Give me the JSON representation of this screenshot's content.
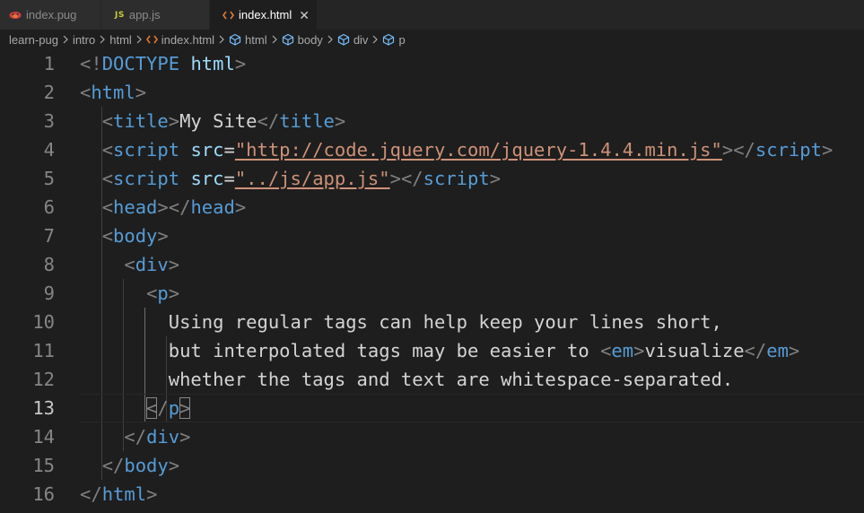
{
  "tabs": [
    {
      "label": "index.pug",
      "icon": "pug-icon"
    },
    {
      "label": "app.js",
      "icon": "js-icon",
      "icon_text": "JS"
    },
    {
      "label": "index.html",
      "icon": "html-icon",
      "icon_text": "<>",
      "close": "✕"
    }
  ],
  "breadcrumb": {
    "folders": [
      "learn-pug",
      "intro",
      "html"
    ],
    "file": "index.html",
    "symbols": [
      "html",
      "body",
      "div",
      "p"
    ]
  },
  "editor": {
    "current_line": 13,
    "lines": [
      {
        "n": "1",
        "tokens": [
          [
            "b",
            "<!"
          ],
          [
            "d",
            "DOCTYPE"
          ],
          [
            "t",
            " "
          ],
          [
            "a",
            "html"
          ],
          [
            "b",
            ">"
          ]
        ]
      },
      {
        "n": "2",
        "tokens": [
          [
            "b",
            "<"
          ],
          [
            "g",
            "html"
          ],
          [
            "b",
            ">"
          ]
        ]
      },
      {
        "n": "3",
        "tokens": [
          [
            "t",
            "  "
          ],
          [
            "b",
            "<"
          ],
          [
            "g",
            "title"
          ],
          [
            "b",
            ">"
          ],
          [
            "t",
            "My Site"
          ],
          [
            "b",
            "</"
          ],
          [
            "g",
            "title"
          ],
          [
            "b",
            ">"
          ]
        ]
      },
      {
        "n": "4",
        "tokens": [
          [
            "t",
            "  "
          ],
          [
            "b",
            "<"
          ],
          [
            "g",
            "script"
          ],
          [
            "t",
            " "
          ],
          [
            "a",
            "src"
          ],
          [
            "t",
            "="
          ],
          [
            "s",
            "\"http://code.jquery.com/jquery-1.4.4.min.js\""
          ],
          [
            "b",
            "></"
          ],
          [
            "g",
            "script"
          ],
          [
            "b",
            ">"
          ]
        ]
      },
      {
        "n": "5",
        "tokens": [
          [
            "t",
            "  "
          ],
          [
            "b",
            "<"
          ],
          [
            "g",
            "script"
          ],
          [
            "t",
            " "
          ],
          [
            "a",
            "src"
          ],
          [
            "t",
            "="
          ],
          [
            "s",
            "\"../js/app.js\""
          ],
          [
            "b",
            "></"
          ],
          [
            "g",
            "script"
          ],
          [
            "b",
            ">"
          ]
        ]
      },
      {
        "n": "6",
        "tokens": [
          [
            "t",
            "  "
          ],
          [
            "b",
            "<"
          ],
          [
            "g",
            "head"
          ],
          [
            "b",
            "></"
          ],
          [
            "g",
            "head"
          ],
          [
            "b",
            ">"
          ]
        ]
      },
      {
        "n": "7",
        "tokens": [
          [
            "t",
            "  "
          ],
          [
            "b",
            "<"
          ],
          [
            "g",
            "body"
          ],
          [
            "b",
            ">"
          ]
        ]
      },
      {
        "n": "8",
        "tokens": [
          [
            "t",
            "    "
          ],
          [
            "b",
            "<"
          ],
          [
            "g",
            "div"
          ],
          [
            "b",
            ">"
          ]
        ]
      },
      {
        "n": "9",
        "tokens": [
          [
            "t",
            "      "
          ],
          [
            "b",
            "<"
          ],
          [
            "g",
            "p"
          ],
          [
            "b",
            ">"
          ]
        ]
      },
      {
        "n": "10",
        "tokens": [
          [
            "t",
            "        Using regular tags can help keep your lines short,"
          ]
        ]
      },
      {
        "n": "11",
        "tokens": [
          [
            "t",
            "        but interpolated tags may be easier to "
          ],
          [
            "b",
            "<"
          ],
          [
            "g",
            "em"
          ],
          [
            "b",
            ">"
          ],
          [
            "t",
            "visualize"
          ],
          [
            "b",
            "</"
          ],
          [
            "g",
            "em"
          ],
          [
            "b",
            ">"
          ]
        ]
      },
      {
        "n": "12",
        "tokens": [
          [
            "t",
            "        whether the tags and text are whitespace-separated."
          ]
        ]
      },
      {
        "n": "13",
        "tokens": [
          [
            "t",
            "      "
          ],
          [
            "m",
            "<"
          ],
          [
            "b",
            "/"
          ],
          [
            "g",
            "p"
          ],
          [
            "m",
            ">"
          ]
        ]
      },
      {
        "n": "14",
        "tokens": [
          [
            "t",
            "    "
          ],
          [
            "b",
            "</"
          ],
          [
            "g",
            "div"
          ],
          [
            "b",
            ">"
          ]
        ]
      },
      {
        "n": "15",
        "tokens": [
          [
            "t",
            "  "
          ],
          [
            "b",
            "</"
          ],
          [
            "g",
            "body"
          ],
          [
            "b",
            ">"
          ]
        ]
      },
      {
        "n": "16",
        "tokens": [
          [
            "b",
            "</"
          ],
          [
            "g",
            "html"
          ],
          [
            "b",
            ">"
          ]
        ]
      }
    ]
  },
  "colors": {
    "background": "#1e1e1e",
    "tag": "#569cd6",
    "attribute": "#9cdcfe",
    "string": "#ce9178",
    "text": "#d4d4d4",
    "bracket": "#808080",
    "line_number": "#858585"
  }
}
